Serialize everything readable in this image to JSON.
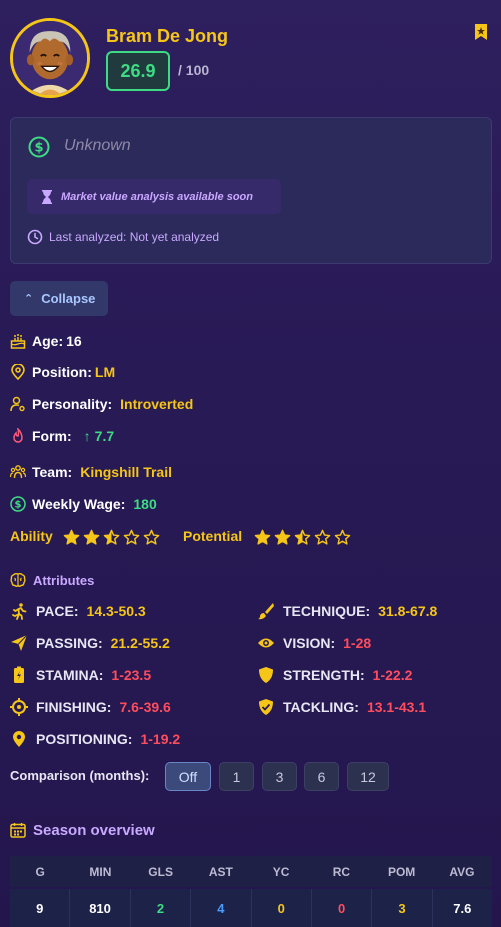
{
  "player": {
    "name": "Bram De Jong",
    "rating": "26.9",
    "rating_max": "/ 100"
  },
  "market": {
    "value": "Unknown",
    "soon_text": "Market value analysis available soon",
    "last_analyzed": "Last analyzed: Not yet analyzed"
  },
  "collapse_label": "Collapse",
  "info": {
    "age_label": "Age:",
    "age_value": "16",
    "position_label": "Position:",
    "position_value": "LM",
    "personality_label": "Personality:",
    "personality_value": "Introverted",
    "form_label": "Form:",
    "form_value": "7.7",
    "team_label": "Team:",
    "team_value": "Kingshill Trail",
    "wage_label": "Weekly Wage:",
    "wage_value": "180"
  },
  "ability": {
    "label": "Ability",
    "stars": 2.5,
    "max": 5
  },
  "potential": {
    "label": "Potential",
    "stars": 2.5,
    "max": 5
  },
  "attributes": {
    "title": "Attributes",
    "items": [
      {
        "label": "PACE:",
        "value": "14.3-50.3",
        "icon": "running-icon",
        "color": "#f5c518"
      },
      {
        "label": "TECHNIQUE:",
        "value": "31.8-67.8",
        "icon": "brush-icon",
        "color": "#f5c518"
      },
      {
        "label": "PASSING:",
        "value": "21.2-55.2",
        "icon": "send-icon",
        "color": "#f5c518"
      },
      {
        "label": "VISION:",
        "value": "1-28",
        "icon": "eye-icon",
        "color": "#ff4d5e"
      },
      {
        "label": "STAMINA:",
        "value": "1-23.5",
        "icon": "battery-icon",
        "color": "#ff4d5e"
      },
      {
        "label": "STRENGTH:",
        "value": "1-22.2",
        "icon": "shield-icon",
        "color": "#ff4d5e"
      },
      {
        "label": "FINISHING:",
        "value": "7.6-39.6",
        "icon": "crosshair-icon",
        "color": "#ff4d5e"
      },
      {
        "label": "TACKLING:",
        "value": "13.1-43.1",
        "icon": "shield-check-icon",
        "color": "#ff4d5e"
      },
      {
        "label": "POSITIONING:",
        "value": "1-19.2",
        "icon": "location-pin-icon",
        "color": "#ff4d5e"
      }
    ]
  },
  "comparison": {
    "label": "Comparison (months):",
    "options": [
      "Off",
      "1",
      "3",
      "6",
      "12"
    ],
    "selected": "Off"
  },
  "season": {
    "title": "Season overview",
    "headers": [
      "G",
      "MIN",
      "GLS",
      "AST",
      "YC",
      "RC",
      "POM",
      "AVG"
    ],
    "values": [
      "9",
      "810",
      "2",
      "4",
      "0",
      "0",
      "3",
      "7.6"
    ],
    "value_colors": [
      "#ffffff",
      "#ffffff",
      "#3ddc84",
      "#4a9dff",
      "#f5c518",
      "#ff4d5e",
      "#f5c518",
      "#ffffff"
    ]
  },
  "colors": {
    "accent_gold": "#f5c518",
    "good_green": "#3ddc84",
    "bad_red": "#ff4d5e",
    "purple": "#c9a8ff"
  }
}
